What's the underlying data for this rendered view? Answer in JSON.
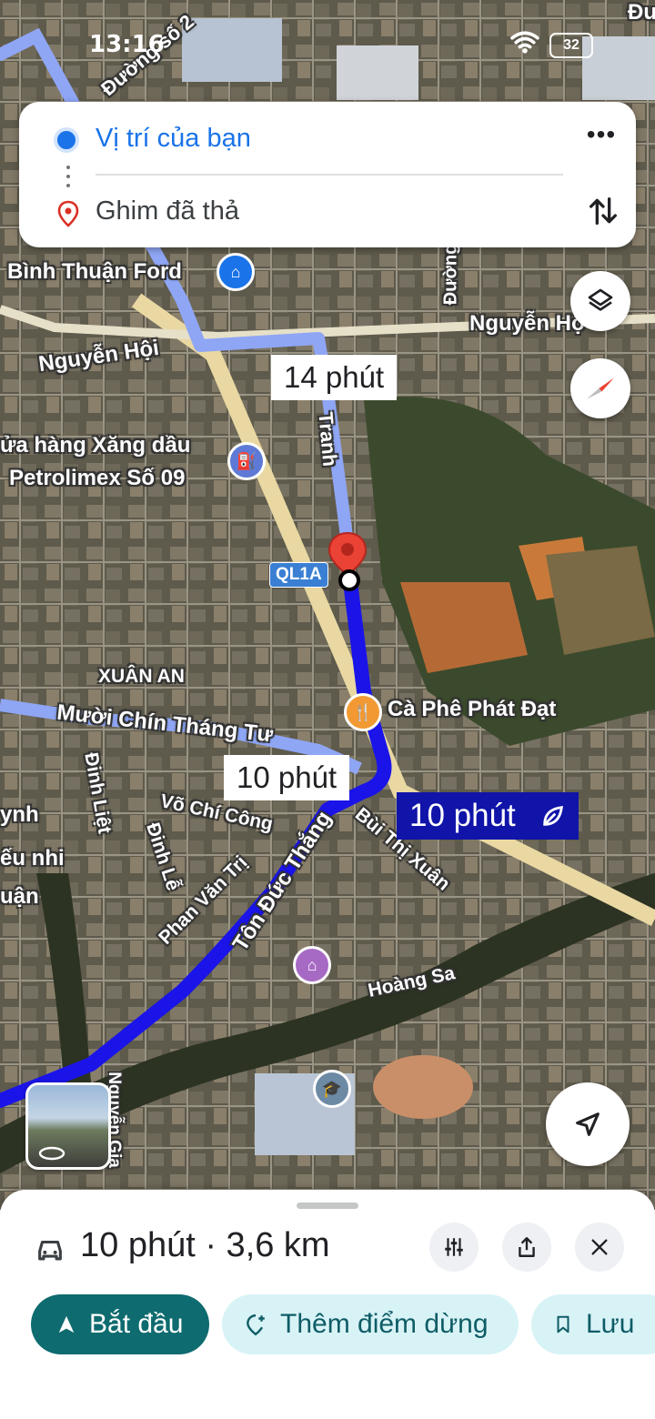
{
  "status_bar": {
    "time": "13:16",
    "battery": "32"
  },
  "search": {
    "origin": "Vị trí của bạn",
    "destination": "Ghim đã thả",
    "more_label": "•••"
  },
  "map": {
    "labels": {
      "duong_so_2": "Đường số 2",
      "binh_thuan_ford": "Bình Thuận Ford",
      "nguyen_hoi_left": "Nguyễn Hội",
      "nguyen_hoi_right": "Nguyễn Hộ",
      "xang_dau_1": "ửa hàng Xăng dầu",
      "xang_dau_2": "Petrolimex Số 09",
      "tranh": "Tranh",
      "duong_top": "Đường",
      "xuan_an": "XUÂN AN",
      "muoi_chin": "Mười Chín Tháng Tư",
      "ca_phe": "Cà Phê Phát Đạt",
      "dinh_liet": "Đinh Liệt",
      "dinh_le": "Đinh Lễ",
      "vo_chi_cong": "Võ Chí Công",
      "phan_van_tri": "Phan Văn Trị",
      "ton_duc_thang": "Tôn Đức Thắng",
      "bui_thi_xuan": "Bùi Thị Xuân",
      "hoang_sa": "Hoàng Sa",
      "ynh": "ynh",
      "eu_nhi": "ếu nhi",
      "uan": "uận",
      "nguyen_gia": "Nguyễn Gia",
      "du": "Đư"
    },
    "route_shield": "QL1A",
    "eta_alt_1": "14 phút",
    "eta_alt_2": "10 phút",
    "eta_primary": "10 phút"
  },
  "sheet": {
    "summary": "10 phút · 3,6 km",
    "start_label": "Bắt đầu",
    "add_stop_label": "Thêm điểm dừng",
    "save_label": "Lưu"
  },
  "colors": {
    "route_primary": "#1a14e8",
    "route_alt": "#8fa6f5",
    "accent_teal": "#0e6b6f",
    "chip_light": "#d8f3f6",
    "eta_primary_bg": "#1014a8"
  }
}
